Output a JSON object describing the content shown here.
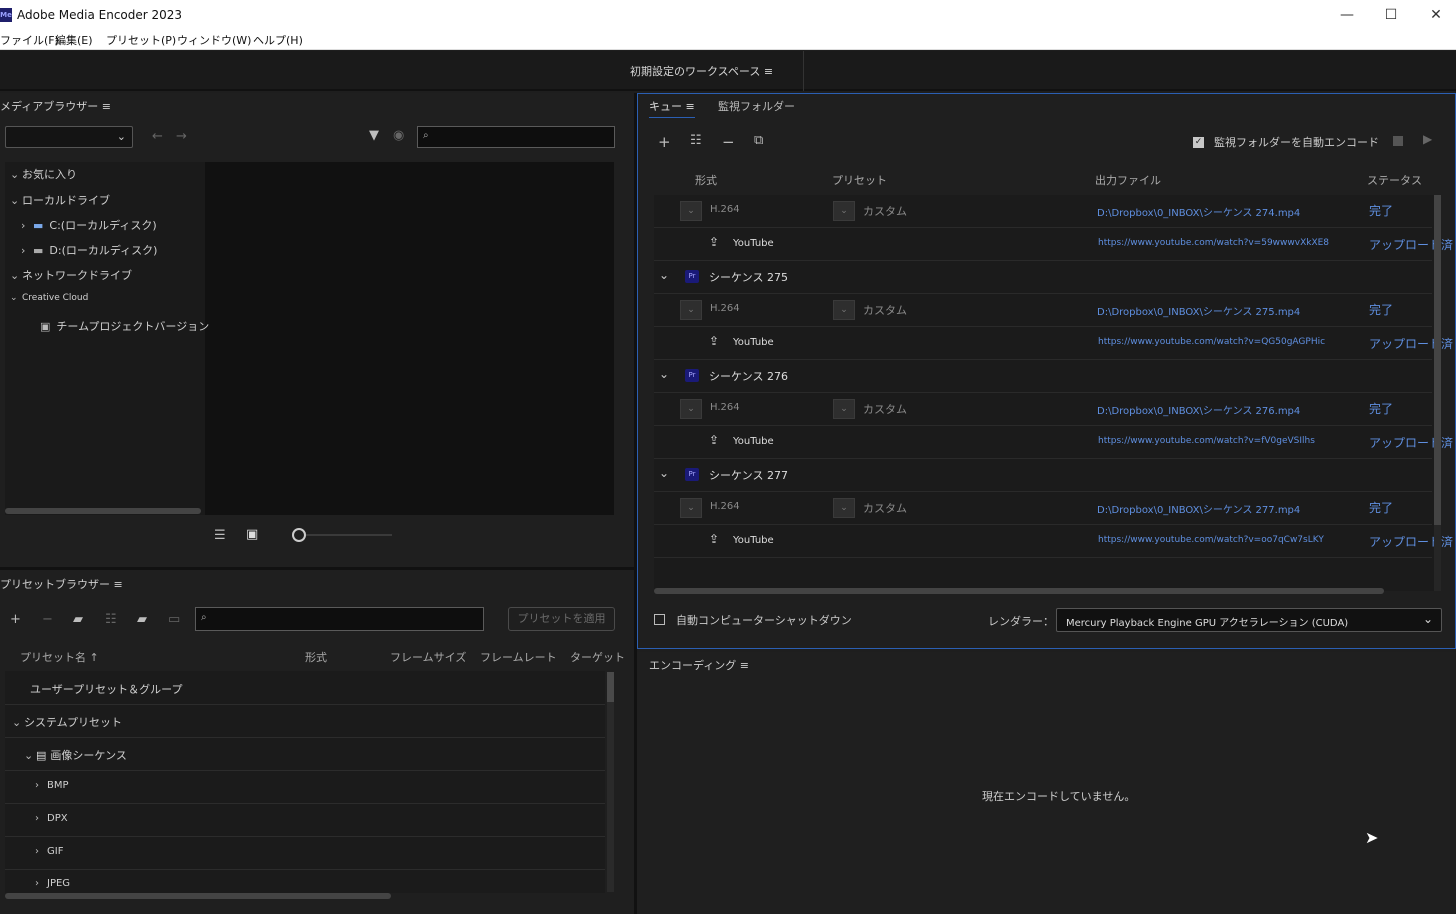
{
  "window": {
    "title": "Adobe Media Encoder 2023",
    "logo_text": "Me",
    "minimize": "—",
    "maximize": "☐",
    "close": "✕"
  },
  "menu": [
    "ファイル(F)",
    "編集(E)",
    "プリセット(P)",
    "ウィンドウ(W)",
    "ヘルプ(H)"
  ],
  "workspace": {
    "label": "初期設定のワークスペース ≡"
  },
  "media_browser": {
    "title": "メディアブラウザー ≡",
    "tree": [
      {
        "label": "お気に入り",
        "chev": "⌄"
      },
      {
        "label": "ローカルドライブ",
        "chev": "⌄"
      },
      {
        "label": "C:(ローカルディスク)",
        "chev": "›"
      },
      {
        "label": "D:(ローカルディスク)",
        "chev": "›"
      },
      {
        "label": "ネットワークドライブ",
        "chev": "⌄"
      },
      {
        "label": "Creative Cloud",
        "chev": "⌄"
      },
      {
        "label": "チームプロジェクトバージョン",
        "chev": ""
      }
    ]
  },
  "preset_browser": {
    "title": "プリセットブラウザー ≡",
    "apply_button": "プリセットを適用",
    "columns": [
      "プリセット名 ↑",
      "形式",
      "フレームサイズ",
      "フレームレート",
      "ターゲット"
    ],
    "rows": [
      {
        "label": "ユーザープリセット＆グループ",
        "chev": ""
      },
      {
        "label": "システムプリセット",
        "chev": "⌄"
      },
      {
        "label": "画像シーケンス",
        "chev": "⌄"
      },
      {
        "label": "BMP",
        "chev": "›"
      },
      {
        "label": "DPX",
        "chev": "›"
      },
      {
        "label": "GIF",
        "chev": "›"
      },
      {
        "label": "JPEG",
        "chev": "›"
      }
    ]
  },
  "queue": {
    "tabs": [
      "キュー ≡",
      "監視フォルダー"
    ],
    "auto_encode_label": "監視フォルダーを自動エンコード",
    "columns": [
      "形式",
      "プリセット",
      "出力ファイル",
      "ステータス"
    ],
    "rows": [
      {
        "type": "enc",
        "format": "H.264",
        "preset": "カスタム",
        "output": "D:\\Dropbox\\0_INBOX\\シーケンス 274.mp4",
        "status": "完了"
      },
      {
        "type": "yt",
        "label": "YouTube",
        "output": "https://www.youtube.com/watch?v=59wwwvXkXE8",
        "status": "アップロード済"
      },
      {
        "type": "seq",
        "label": "シーケンス 275",
        "badge": "Pr"
      },
      {
        "type": "enc",
        "format": "H.264",
        "preset": "カスタム",
        "output": "D:\\Dropbox\\0_INBOX\\シーケンス 275.mp4",
        "status": "完了"
      },
      {
        "type": "yt",
        "label": "YouTube",
        "output": "https://www.youtube.com/watch?v=QG50gAGPHic",
        "status": "アップロード済"
      },
      {
        "type": "seq",
        "label": "シーケンス 276",
        "badge": "Pr"
      },
      {
        "type": "enc",
        "format": "H.264",
        "preset": "カスタム",
        "output": "D:\\Dropbox\\0_INBOX\\シーケンス 276.mp4",
        "status": "完了"
      },
      {
        "type": "yt",
        "label": "YouTube",
        "output": "https://www.youtube.com/watch?v=fV0geVSIlhs",
        "status": "アップロード済"
      },
      {
        "type": "seq",
        "label": "シーケンス 277",
        "badge": "Pr"
      },
      {
        "type": "enc",
        "format": "H.264",
        "preset": "カスタム",
        "output": "D:\\Dropbox\\0_INBOX\\シーケンス 277.mp4",
        "status": "完了"
      },
      {
        "type": "yt",
        "label": "YouTube",
        "output": "https://www.youtube.com/watch?v=oo7qCw7sLKY",
        "status": "アップロード済"
      }
    ],
    "auto_shutdown_label": "自動コンピューターシャットダウン",
    "renderer_label": "レンダラー：",
    "renderer_value": "Mercury Playback Engine GPU アクセラレーション (CUDA)"
  },
  "encoding": {
    "title": "エンコーディング ≡",
    "idle_message": "現在エンコードしていません。"
  },
  "colors": {
    "accent": "#2b5fb3",
    "link": "#5f8fe0"
  }
}
